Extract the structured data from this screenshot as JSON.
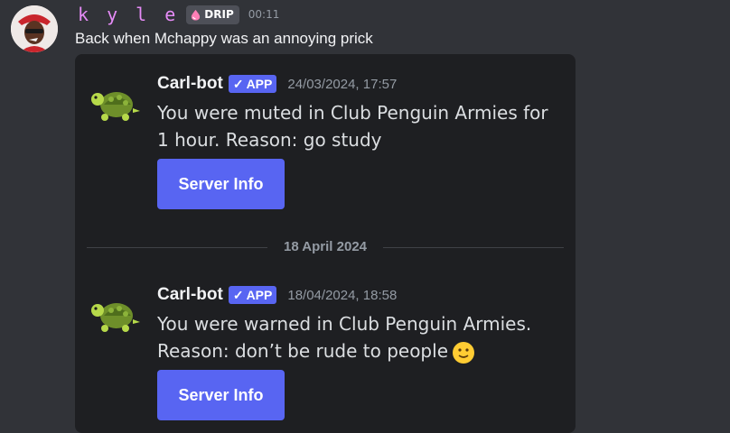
{
  "message": {
    "username": "k y l e",
    "role_tag": "DRIP",
    "time": "00:11",
    "text": "Back when Mchappy was an annoying prick"
  },
  "embed": {
    "entries": [
      {
        "bot_name": "Carl-bot",
        "app_tag": "APP",
        "timestamp": "24/03/2024, 17:57",
        "text": "You were muted in Club Penguin Armies for 1 hour. Reason: go study",
        "button_label": "Server Info",
        "avatar_icon": "turtle-emoji-icon"
      },
      {
        "bot_name": "Carl-bot",
        "app_tag": "APP",
        "timestamp": "18/04/2024, 18:58",
        "text": "You were warned in Club Penguin Armies. Reason: don’t be rude to people",
        "trailing_emoji": "slightly-smiling-face-icon",
        "button_label": "Server Info",
        "avatar_icon": "turtle-emoji-icon"
      }
    ],
    "date_divider": "18 April 2024"
  },
  "colors": {
    "background": "#313338",
    "embed_background": "#1e1f22",
    "username": "#e58bf6",
    "blurple": "#5865f2",
    "muted_text": "#949ba4"
  }
}
